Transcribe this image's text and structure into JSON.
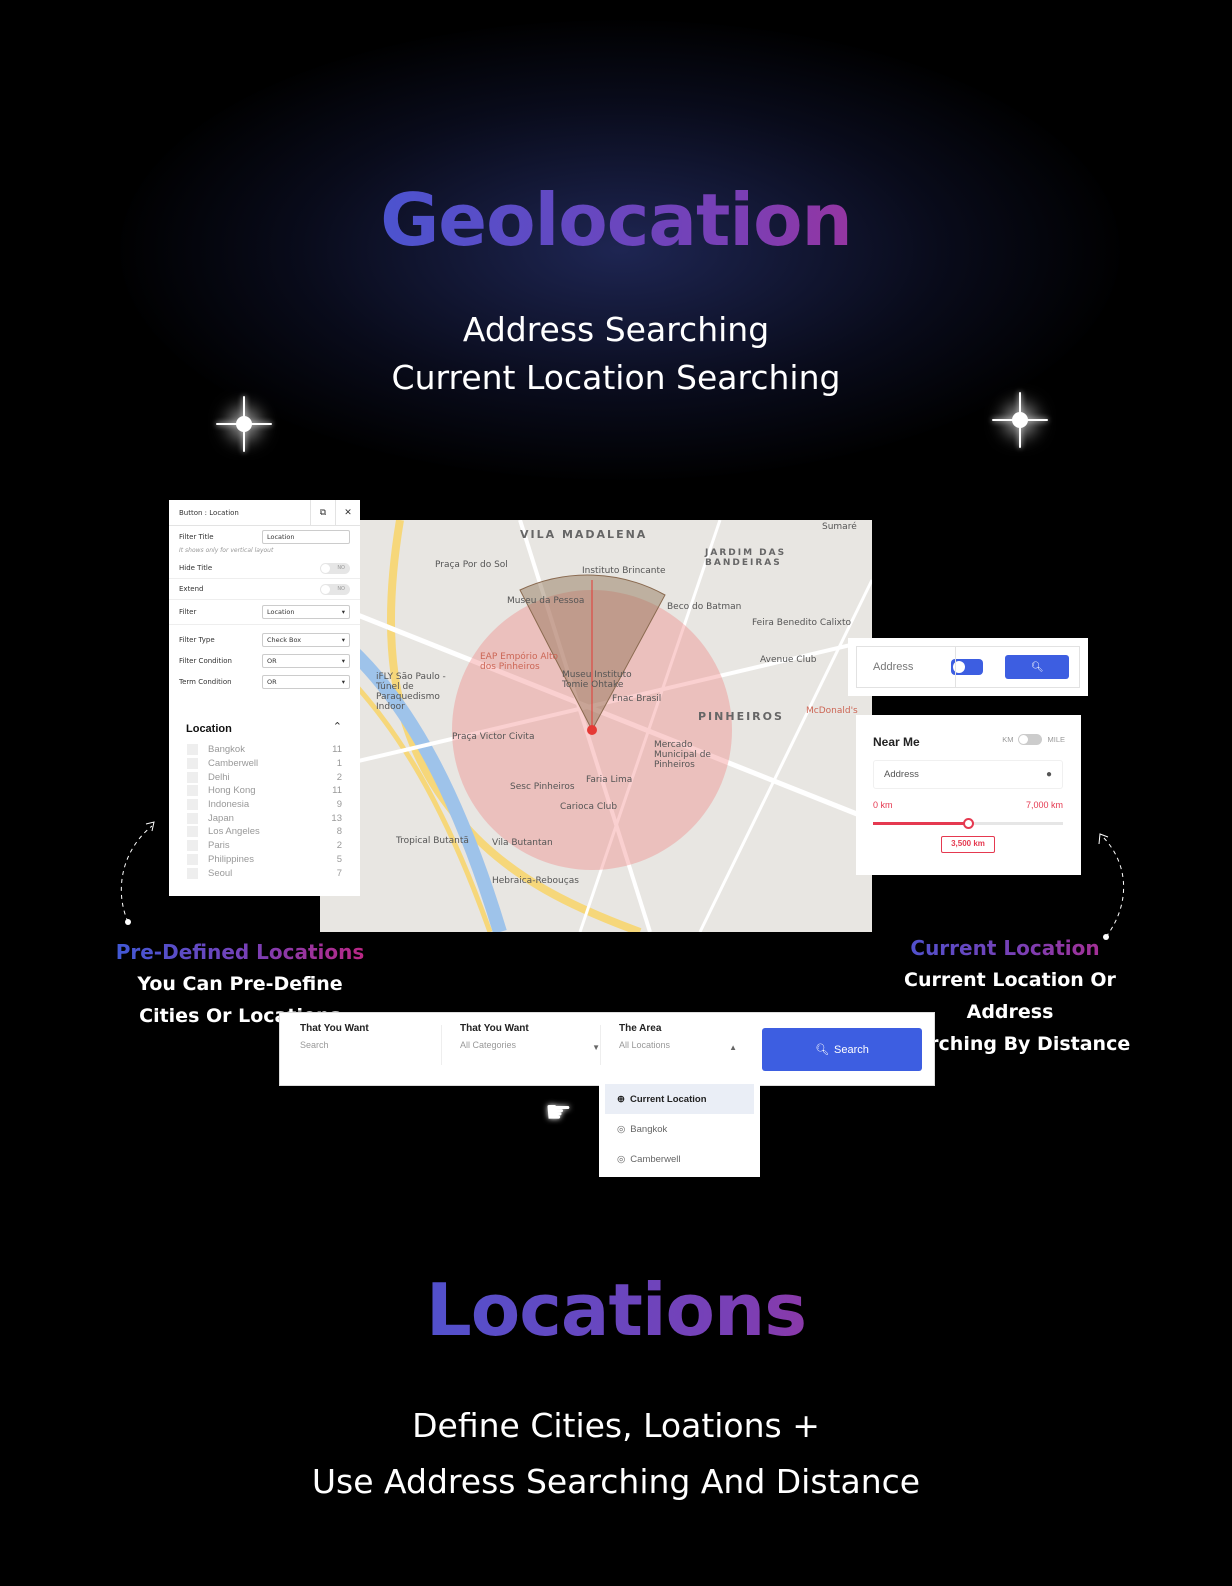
{
  "hero": {
    "title": "Geolocation",
    "subtitle_lines": [
      "Address Searching",
      "Current Location Searching"
    ]
  },
  "filter_panel": {
    "header": "Button : Location",
    "filter_title_label": "Filter Title",
    "filter_title_value": "Location",
    "hint": "It shows only for vertical layout",
    "hide_title_label": "Hide Title",
    "extend_label": "Extend",
    "toggle_off": "NO",
    "filter_label": "Filter",
    "filter_value": "Location",
    "filter_type_label": "Filter Type",
    "filter_type_value": "Check Box",
    "filter_condition_label": "Filter Condition",
    "filter_condition_value": "OR",
    "term_condition_label": "Term Condition",
    "term_condition_value": "OR"
  },
  "location_list": {
    "title": "Location",
    "items": [
      {
        "name": "Bangkok",
        "count": "11"
      },
      {
        "name": "Camberwell",
        "count": "1"
      },
      {
        "name": "Delhi",
        "count": "2"
      },
      {
        "name": "Hong Kong",
        "count": "11"
      },
      {
        "name": "Indonesia",
        "count": "9"
      },
      {
        "name": "Japan",
        "count": "13"
      },
      {
        "name": "Los Angeles",
        "count": "8"
      },
      {
        "name": "Paris",
        "count": "2"
      },
      {
        "name": "Philippines",
        "count": "5"
      },
      {
        "name": "Seoul",
        "count": "7"
      }
    ]
  },
  "map": {
    "districts": [
      "VILA MADALENA",
      "JARDIM DAS BANDEIRAS",
      "PINHEIROS"
    ],
    "labels": [
      "Praça Por do Sol",
      "Instituto Brincante",
      "Museu da Pessoa",
      "Beco do Batman",
      "Feira Benedito Calixto",
      "Avenue Club",
      "EAP Empório Alto dos Pinheiros",
      "Museu Instituto Tomie Ohtake",
      "Fnac Brasil",
      "Praça Victor Civita",
      "Mercado Municipal de Pinheiros",
      "Sesc Pinheiros",
      "Faria Lima",
      "Carioca Club",
      "Tropical Butantã",
      "Vila Butantan",
      "Hebraica-Rebouças",
      "Sumaré",
      "McDonald's",
      "iFLY São Paulo - Túnel de Paraquedismo Indoor"
    ],
    "accent": "#e53935"
  },
  "address_widget": {
    "label": "Address",
    "toggle_color": "#3d5ee1",
    "search_icon": "search-icon"
  },
  "near_me": {
    "title": "Near Me",
    "unit_left": "KM",
    "unit_right": "MILE",
    "address_placeholder": "Address",
    "min": "0 km",
    "max": "7,000 km",
    "value_label": "3,500 km",
    "value_fraction": 0.5
  },
  "callouts": {
    "left_title": "Pre-Defined Locations",
    "left_lines": [
      "You Can Pre-Define",
      "Cities Or Locations"
    ],
    "right_title": "Current Location",
    "right_lines": [
      "Current Location Or Address",
      "Searching By Distance"
    ]
  },
  "search_bar": {
    "field1_label": "That You Want",
    "field1_placeholder": "Search",
    "field2_label": "That You Want",
    "field2_value": "All Categories",
    "field3_label": "The Area",
    "field3_value": "All Locations",
    "button": "Search"
  },
  "dropdown": {
    "items": [
      "Current Location",
      "Bangkok",
      "Camberwell"
    ]
  },
  "footer": {
    "title": "Locations",
    "lines": [
      "Define Cities, Loations +",
      "Use Address Searching And Distance"
    ]
  }
}
